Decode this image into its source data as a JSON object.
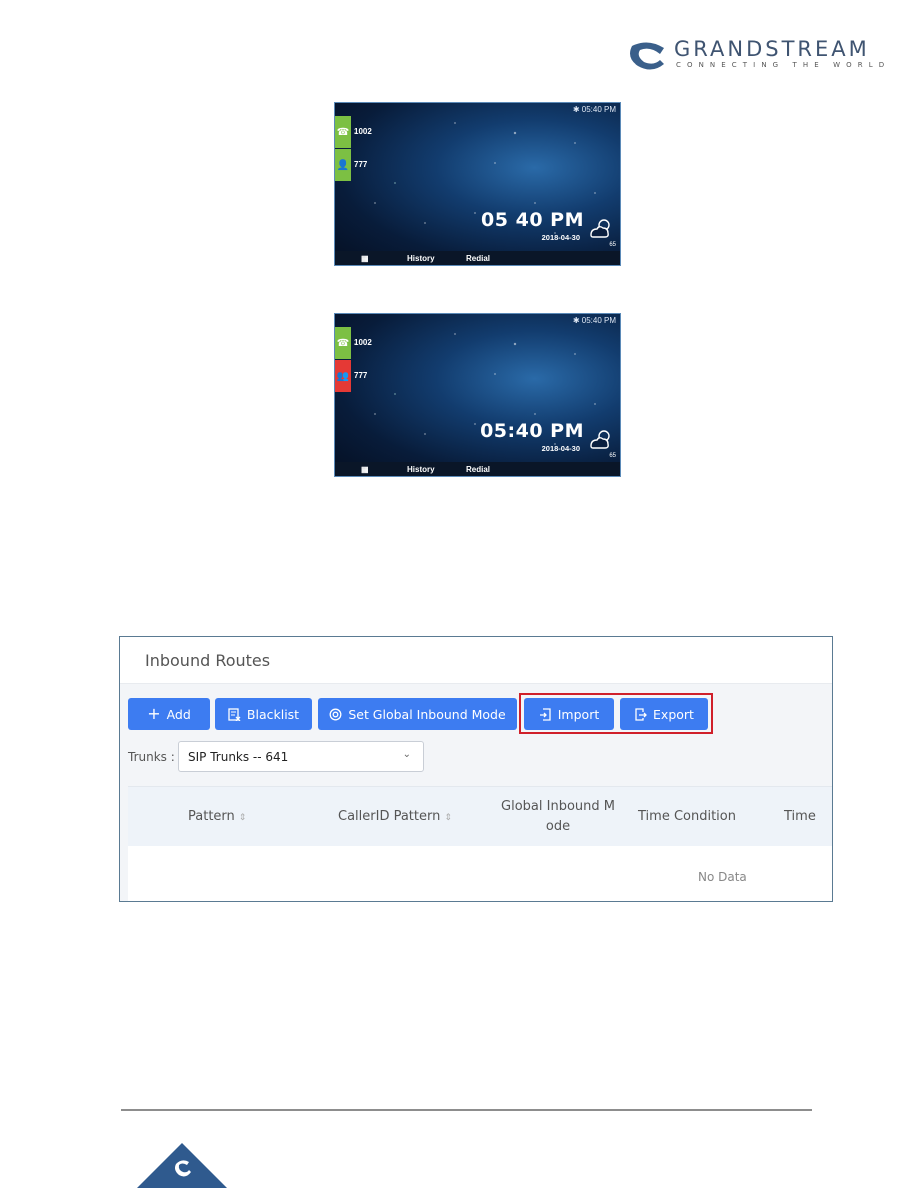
{
  "brand": {
    "name": "GRANDSTREAM",
    "tagline": "CONNECTING THE WORLD",
    "color": "#3f5471"
  },
  "phone_screens": [
    {
      "status_time": "05:40 PM",
      "lines": [
        {
          "label": "1002",
          "icon": "phone-handset-icon",
          "state": "green"
        },
        {
          "label": "777",
          "icon": "contact-icon",
          "state": "green"
        }
      ],
      "clock": "05 40 PM",
      "date": "2018-04-30",
      "temperature": "65",
      "weather_icon": "partly-cloudy-icon",
      "softkeys": [
        "History",
        "Redial"
      ]
    },
    {
      "status_time": "05:40 PM",
      "lines": [
        {
          "label": "1002",
          "icon": "phone-handset-icon",
          "state": "green"
        },
        {
          "label": "777",
          "icon": "contacts-busy-icon",
          "state": "red"
        }
      ],
      "clock": "05:40 PM",
      "date": "2018-04-30",
      "temperature": "65",
      "weather_icon": "partly-cloudy-icon",
      "softkeys": [
        "History",
        "Redial"
      ]
    }
  ],
  "inbound_routes": {
    "title": "Inbound Routes",
    "buttons": {
      "add": "Add",
      "blacklist": "Blacklist",
      "global_mode": "Set Global Inbound Mode",
      "import": "Import",
      "export": "Export"
    },
    "trunks_label": "Trunks :",
    "trunk_selected": "SIP Trunks -- 641",
    "columns": [
      "Pattern",
      "CallerID Pattern",
      "Global Inbound M ode",
      "Time Condition",
      "Time"
    ],
    "empty_text": "No Data",
    "accent_color": "#3d7cf1",
    "highlight_color": "#d0202a"
  }
}
